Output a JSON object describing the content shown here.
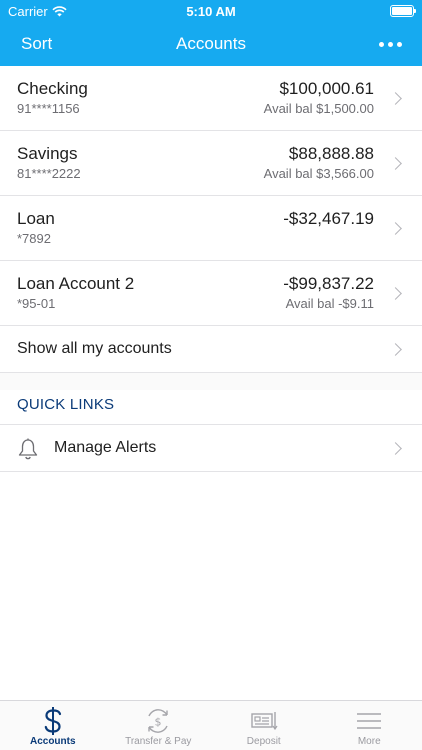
{
  "status": {
    "carrier": "Carrier",
    "time": "5:10 AM"
  },
  "navbar": {
    "sort_label": "Sort",
    "title": "Accounts"
  },
  "accounts": [
    {
      "name": "Checking",
      "number": "91****1156",
      "balance": "$100,000.61",
      "available": "Avail bal $1,500.00"
    },
    {
      "name": "Savings",
      "number": "81****2222",
      "balance": "$88,888.88",
      "available": "Avail bal $3,566.00"
    },
    {
      "name": "Loan",
      "number": "*7892",
      "balance": "-$32,467.19",
      "available": ""
    },
    {
      "name": "Loan Account 2",
      "number": "*95-01",
      "balance": "-$99,837.22",
      "available": "Avail bal -$9.11"
    }
  ],
  "show_all_label": "Show all my accounts",
  "quick_links": {
    "header": "QUICK LINKS",
    "items": [
      {
        "label": "Manage Alerts",
        "icon": "bell-icon"
      }
    ]
  },
  "tabs": [
    {
      "label": "Accounts",
      "icon": "dollar-icon",
      "active": true
    },
    {
      "label": "Transfer & Pay",
      "icon": "transfer-icon",
      "active": false
    },
    {
      "label": "Deposit",
      "icon": "check-deposit-icon",
      "active": false
    },
    {
      "label": "More",
      "icon": "menu-icon",
      "active": false
    }
  ],
  "colors": {
    "header_bg": "#16aaf0",
    "accent": "#0a3a78"
  }
}
